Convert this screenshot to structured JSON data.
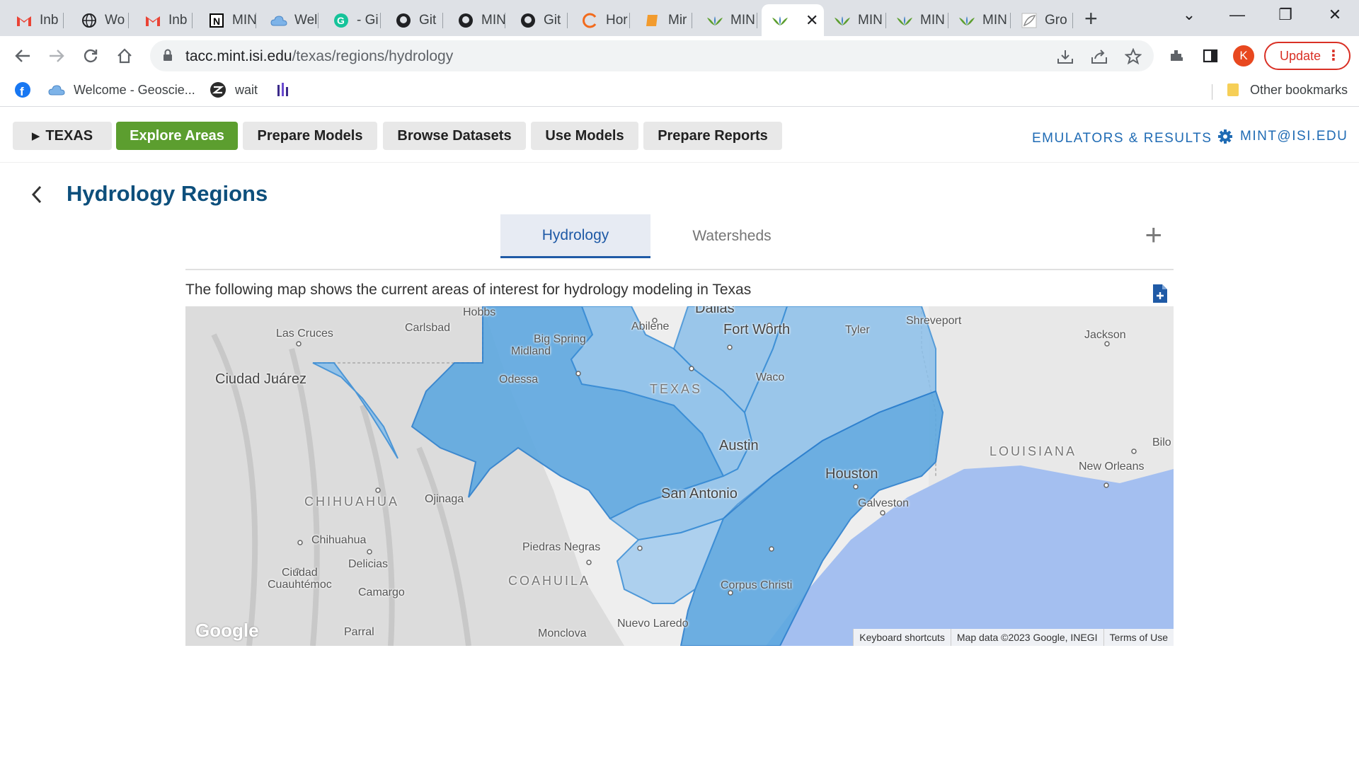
{
  "browser": {
    "tabs": [
      {
        "label": "Inb",
        "icon": "gmail-icon"
      },
      {
        "label": "Wo",
        "icon": "globe-icon"
      },
      {
        "label": "Inb",
        "icon": "gmail-icon"
      },
      {
        "label": "MIN",
        "icon": "notion-icon"
      },
      {
        "label": "Wel",
        "icon": "cloud-icon"
      },
      {
        "label": "- Gi",
        "icon": "grammarly-icon"
      },
      {
        "label": "Git",
        "icon": "github-icon"
      },
      {
        "label": "MIN",
        "icon": "github-icon"
      },
      {
        "label": "Git",
        "icon": "github-icon"
      },
      {
        "label": "Hor",
        "icon": "loading-icon"
      },
      {
        "label": "Mir",
        "icon": "book-icon"
      },
      {
        "label": "MIN",
        "icon": "mint-icon"
      },
      {
        "label": "",
        "icon": "mint-icon",
        "active": true
      },
      {
        "label": "MIN",
        "icon": "mint-icon"
      },
      {
        "label": "MIN",
        "icon": "mint-icon"
      },
      {
        "label": "MIN",
        "icon": "mint-icon"
      },
      {
        "label": "Gro",
        "icon": "leaf-icon"
      }
    ],
    "url_host": "tacc.mint.isi.edu",
    "url_path": "/texas/regions/hydrology",
    "avatar_letter": "K",
    "update_label": "Update",
    "bookmarks": [
      {
        "label": "",
        "icon": "facebook-icon"
      },
      {
        "label": "Welcome - Geoscie...",
        "icon": "cloud-icon"
      },
      {
        "label": "wait",
        "icon": "zotero-icon"
      },
      {
        "label": "",
        "icon": "bars-icon"
      }
    ],
    "other_bookmarks": "Other bookmarks"
  },
  "app": {
    "nav": {
      "region": "TEXAS",
      "items": [
        "Explore Areas",
        "Prepare Models",
        "Browse Datasets",
        "Use Models",
        "Prepare Reports"
      ],
      "active_item": "Explore Areas",
      "emulators_link": "EMULATORS & RESULTS",
      "user_link": "MINT@ISI.EDU"
    },
    "page_title": "Hydrology Regions",
    "tabs": [
      "Hydrology",
      "Watersheds"
    ],
    "active_tab": "Hydrology",
    "description": "The following map shows the current areas of interest for hydrology modeling in Texas",
    "colors": {
      "accent_green": "#5c9e2f",
      "link_blue": "#1f6bb4",
      "title_blue": "#0d4f7c",
      "region_fill": "#5ea8e0",
      "water": "#a4bff0"
    }
  },
  "map": {
    "labels": {
      "hobbs": "Hobbs",
      "las_cruces": "Las Cruces",
      "carlsbad": "Carlsbad",
      "big_spring": "Big Spring",
      "midland": "Midland",
      "odessa": "Odessa",
      "ciudad_juarez": "Ciudad Juárez",
      "abilene": "Abilene",
      "dallas": "Dallas",
      "fort_worth": "Fort Worth",
      "tyler": "Tyler",
      "shreveport": "Shreveport",
      "jackson": "Jackson",
      "texas": "TEXAS",
      "waco": "Waco",
      "louisiana": "LOUISIANA",
      "austin": "Austin",
      "houston": "Houston",
      "new_orleans": "New Orleans",
      "biloxi": "Bilo",
      "chihuahua_state": "CHIHUAHUA",
      "ojinaga": "Ojinaga",
      "san_antonio": "San Antonio",
      "galveston": "Galveston",
      "chihuahua": "Chihuahua",
      "piedras_negras": "Piedras Negras",
      "delicias": "Delicias",
      "ciudad_cuauhtemoc": "Ciudad\nCuauhtémoc",
      "coahuila": "COAHUILA",
      "camargo": "Camargo",
      "corpus_christi": "Corpus Christi",
      "nuevo_laredo": "Nuevo Laredo",
      "parral": "Parral",
      "monclova": "Monclova"
    },
    "google_logo": "Google",
    "attribution": {
      "shortcuts": "Keyboard shortcuts",
      "data": "Map data ©2023 Google, INEGI",
      "terms": "Terms of Use"
    }
  }
}
